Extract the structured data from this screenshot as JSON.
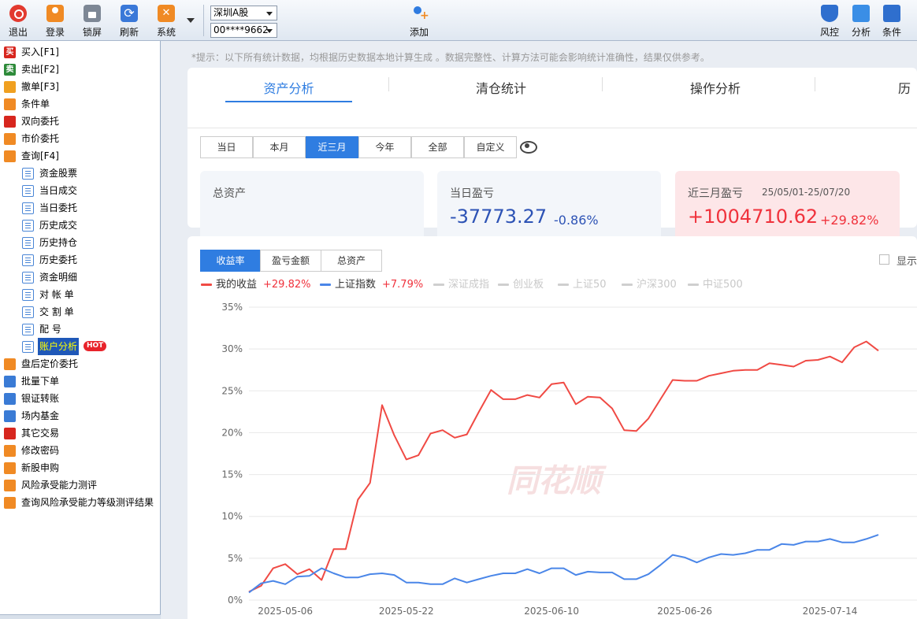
{
  "toolbar": {
    "left": [
      {
        "label": "退出",
        "icon": "power-icon"
      },
      {
        "label": "登录",
        "icon": "user-login-icon"
      },
      {
        "label": "锁屏",
        "icon": "lock-icon"
      },
      {
        "label": "刷新",
        "icon": "refresh-icon"
      },
      {
        "label": "系统",
        "icon": "tools-icon"
      }
    ],
    "market_select": "深圳A股",
    "account_select": "00****9662",
    "add_label": "添加",
    "right": [
      {
        "label": "风控",
        "icon": "shield-icon"
      },
      {
        "label": "分析",
        "icon": "analysis-icon"
      },
      {
        "label": "条件",
        "icon": "condition-icon"
      }
    ]
  },
  "sidebar": {
    "items": [
      {
        "label": "买入[F1]",
        "icon": "buy-icon",
        "glyph": "买"
      },
      {
        "label": "卖出[F2]",
        "icon": "sell-icon",
        "glyph": "卖"
      },
      {
        "label": "撤单[F3]",
        "icon": "cancel-hand-icon"
      },
      {
        "label": "条件单",
        "icon": "condition-order-icon"
      },
      {
        "label": "双向委托",
        "icon": "two-way-arrows-icon"
      },
      {
        "label": "市价委托",
        "icon": "market-order-icon"
      },
      {
        "label": "查询[F4]",
        "icon": "search-icon"
      },
      {
        "label": "资金股票",
        "icon": "doc-icon",
        "child": true
      },
      {
        "label": "当日成交",
        "icon": "doc-icon",
        "child": true
      },
      {
        "label": "当日委托",
        "icon": "doc-icon",
        "child": true
      },
      {
        "label": "历史成交",
        "icon": "doc-icon",
        "child": true
      },
      {
        "label": "历史持仓",
        "icon": "doc-icon",
        "child": true
      },
      {
        "label": "历史委托",
        "icon": "doc-icon",
        "child": true
      },
      {
        "label": "资金明细",
        "icon": "doc-icon",
        "child": true
      },
      {
        "label": "对 帐 单",
        "icon": "doc-icon",
        "child": true
      },
      {
        "label": "交 割 单",
        "icon": "doc-icon",
        "child": true
      },
      {
        "label": "配    号",
        "icon": "doc-icon",
        "child": true
      },
      {
        "label": "账户分析",
        "icon": "doc-icon",
        "child": true,
        "selected": true,
        "badge": "HOT"
      },
      {
        "label": "盘后定价委托",
        "icon": "after-hours-icon"
      },
      {
        "label": "批量下单",
        "icon": "batch-order-icon"
      },
      {
        "label": "银证转账",
        "icon": "bank-transfer-icon"
      },
      {
        "label": "场内基金",
        "icon": "fund-icon"
      },
      {
        "label": "其它交易",
        "icon": "other-trade-icon"
      },
      {
        "label": "修改密码",
        "icon": "key-icon"
      },
      {
        "label": "新股申购",
        "icon": "ipo-icon"
      },
      {
        "label": "风险承受能力测评",
        "icon": "risk-test-icon"
      },
      {
        "label": "查询风险承受能力等级测评结果",
        "icon": "risk-result-icon"
      }
    ]
  },
  "tip": "*提示：以下所有统计数据，均根据历史数据本地计算生成 。数据完整性、计算方法可能会影响统计准确性，结果仅供参考。",
  "tabs": [
    "资产分析",
    "清仓统计",
    "操作分析",
    "历"
  ],
  "periods": [
    "当日",
    "本月",
    "近三月",
    "今年",
    "全部",
    "自定义"
  ],
  "active_period": "近三月",
  "stats": {
    "total": {
      "label": "总资产",
      "value": ""
    },
    "today": {
      "label": "当日盈亏",
      "value": "-37773.27",
      "pct": "-0.86%"
    },
    "range": {
      "label": "近三月盈亏",
      "dates": "25/05/01-25/07/20",
      "value": "+1004710.62",
      "pct": "+29.82%"
    }
  },
  "chart_tabs": [
    "收益率",
    "盈亏金额",
    "总资产"
  ],
  "show_label": "显示",
  "legend": [
    {
      "name": "我的收益",
      "value": "+29.82%",
      "color": "#f04a44",
      "active": true
    },
    {
      "name": "上证指数",
      "value": "+7.79%",
      "color": "#4a86e8",
      "active": true
    },
    {
      "name": "深证成指",
      "value": "",
      "color": "#cfcfcf",
      "active": false
    },
    {
      "name": "创业板",
      "value": "",
      "color": "#cfcfcf",
      "active": false
    },
    {
      "name": "上证50",
      "value": "",
      "color": "#cfcfcf",
      "active": false
    },
    {
      "name": "沪深300",
      "value": "",
      "color": "#cfcfcf",
      "active": false
    },
    {
      "name": "中证500",
      "value": "",
      "color": "#cfcfcf",
      "active": false
    }
  ],
  "watermark": "同花顺",
  "chart_data": {
    "type": "line",
    "x_ticks": [
      "2025-05-06",
      "2025-05-22",
      "2025-06-10",
      "2025-06-26",
      "2025-07-14"
    ],
    "y_ticks": [
      "35%",
      "30%",
      "25%",
      "20%",
      "15%",
      "10%",
      "5%",
      "0%"
    ],
    "ylim": [
      0,
      35
    ],
    "grid": true,
    "series": [
      {
        "name": "我的收益",
        "color": "#f04a44",
        "values": [
          1.0,
          1.7,
          3.8,
          4.3,
          3.1,
          3.7,
          2.4,
          6.1,
          6.1,
          12.0,
          14.0,
          23.3,
          19.7,
          16.8,
          17.3,
          19.9,
          20.3,
          19.4,
          19.8,
          22.5,
          25.1,
          24.0,
          24.0,
          24.5,
          24.2,
          25.8,
          26.0,
          23.4,
          24.3,
          24.2,
          22.9,
          20.3,
          20.2,
          21.7,
          24.0,
          26.3,
          26.2,
          26.2,
          26.8,
          27.1,
          27.4,
          27.5,
          27.5,
          28.3,
          28.1,
          27.9,
          28.6,
          28.7,
          29.1,
          28.4,
          30.2,
          30.9,
          29.8
        ]
      },
      {
        "name": "上证指数",
        "color": "#4a86e8",
        "values": [
          0.9,
          2.0,
          2.3,
          1.9,
          2.8,
          2.9,
          3.8,
          3.2,
          2.7,
          2.7,
          3.1,
          3.2,
          3.0,
          2.1,
          2.1,
          1.9,
          1.9,
          2.6,
          2.1,
          2.5,
          2.9,
          3.2,
          3.2,
          3.7,
          3.2,
          3.8,
          3.8,
          3.0,
          3.4,
          3.3,
          3.3,
          2.5,
          2.5,
          3.1,
          4.2,
          5.4,
          5.1,
          4.5,
          5.1,
          5.5,
          5.4,
          5.6,
          6.0,
          6.0,
          6.7,
          6.6,
          7.0,
          7.0,
          7.3,
          6.9,
          6.9,
          7.3,
          7.8
        ]
      }
    ]
  }
}
